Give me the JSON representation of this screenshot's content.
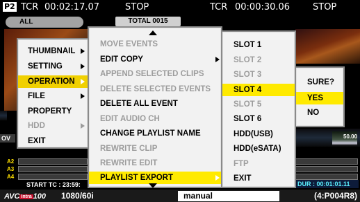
{
  "top_bar": {
    "card_icon": "P2",
    "tcr_label_1": "TCR",
    "tcr_value_1": "00:02:17.07",
    "status_1": "STOP",
    "tcr_label_2": "TCR",
    "tcr_value_2": "00:00:30.06",
    "status_2": "STOP"
  },
  "filter_pill": "ALL",
  "total_label": "TOTAL 0015",
  "timeline": {
    "tracks": [
      "A2",
      "A3",
      "A4"
    ],
    "ov_label": "OV",
    "start_tc": "START TC : 23:59:",
    "dur_tc": "DUR : 00:01:01.11",
    "tc_right": "50.00"
  },
  "bottom_bar": {
    "codec_logo": "AVC",
    "codec_badge": "Intra",
    "codec_num": "100",
    "format": "1080/60i",
    "mode": "manual",
    "clip": "(4:P004R8)"
  },
  "main_menu": [
    {
      "label": "THUMBNAIL",
      "submenu": true
    },
    {
      "label": "SETTING",
      "submenu": true
    },
    {
      "label": "OPERATION",
      "submenu": true,
      "selected": true
    },
    {
      "label": "FILE",
      "submenu": true
    },
    {
      "label": "PROPERTY"
    },
    {
      "label": "HDD",
      "submenu": true,
      "disabled": true
    },
    {
      "label": "EXIT"
    }
  ],
  "operation_menu": [
    {
      "label": "MOVE EVENTS",
      "disabled": true
    },
    {
      "label": "EDIT COPY",
      "submenu": true
    },
    {
      "label": "APPEND SELECTED CLIPS",
      "disabled": true
    },
    {
      "label": "DELETE SELECTED EVENTS",
      "disabled": true
    },
    {
      "label": "DELETE ALL EVENT"
    },
    {
      "label": "EDIT AUDIO CH",
      "disabled": true
    },
    {
      "label": "CHANGE PLAYLIST NAME"
    },
    {
      "label": "REWRITE CLIP",
      "disabled": true
    },
    {
      "label": "REWRITE EDIT",
      "disabled": true
    },
    {
      "label": "PLAYLIST EXPORT",
      "submenu": true,
      "selected": true
    }
  ],
  "export_menu": [
    {
      "label": "SLOT 1"
    },
    {
      "label": "SLOT 2",
      "disabled": true
    },
    {
      "label": "SLOT 3",
      "disabled": true
    },
    {
      "label": "SLOT 4",
      "selected": true
    },
    {
      "label": "SLOT 5",
      "disabled": true
    },
    {
      "label": "SLOT 6"
    },
    {
      "label": "HDD(USB)"
    },
    {
      "label": "HDD(eSATA)"
    },
    {
      "label": "FTP",
      "disabled": true
    },
    {
      "label": "EXIT"
    }
  ],
  "confirm_menu": {
    "prompt": "SURE?",
    "yes": "YES",
    "no": "NO"
  },
  "colors": {
    "highlight": "#ffea00",
    "disabled_text": "#9c9c9c",
    "menu_bg": "#f2f2f2",
    "duration_text": "#5af0ff"
  }
}
